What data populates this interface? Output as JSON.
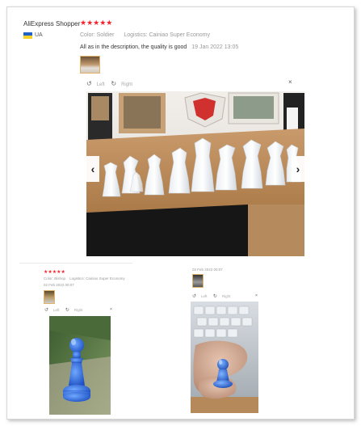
{
  "main_review": {
    "user": "AliExpress Shopper",
    "rating": "★★★★★",
    "country": "UA",
    "color_label": "Color:",
    "color_value": "Soldier",
    "logistics_label": "Logistics:",
    "logistics_value": "Cainiao Super Economy",
    "comment": "All as in the description, the quality is good",
    "date": "19 Jan 2022 13:05",
    "viewer": {
      "rotate_left": "Left",
      "rotate_right": "Right",
      "close": "×"
    },
    "nav_prev": "‹",
    "nav_next": "›"
  },
  "left_review": {
    "rating": "★★★★★",
    "color_label": "Color:",
    "color_value": "Bishop",
    "logistics_label": "Logistics:",
    "logistics_value": "Cainiao Super Economy",
    "date": "02 Feb 2022 00:07",
    "viewer": {
      "rotate_left": "Left",
      "rotate_right": "Right",
      "close": "×"
    }
  },
  "right_review": {
    "date": "02 Feb 2022 00:07",
    "viewer": {
      "rotate_left": "Left",
      "rotate_right": "Right",
      "close": "×"
    }
  },
  "colors": {
    "star": "#f5222d",
    "flag_blue": "#1e62c8",
    "flag_yellow": "#f6d224",
    "muted_text": "#999999"
  },
  "icons": {
    "rotate_left": "rotate-left-icon",
    "rotate_right": "rotate-right-icon",
    "close": "close-icon",
    "prev": "chevron-left-icon",
    "next": "chevron-right-icon"
  }
}
